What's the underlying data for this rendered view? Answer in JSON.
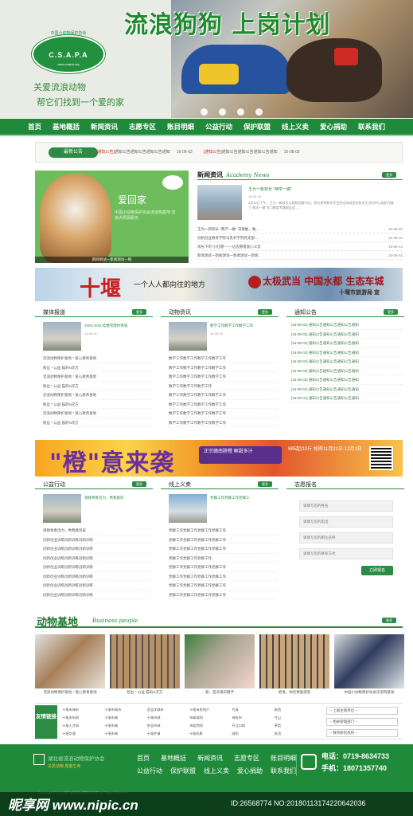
{
  "header": {
    "banner_title": "流浪狗狗 上岗计划",
    "logo_org_cn": "中国小动物保护协会",
    "logo_abbr": "C.S.A.P.A",
    "logo_url": "www.csapa.org",
    "slogan_line1": "关爱流浪动物",
    "slogan_line2": "帮它们找到一个爱的家",
    "slide_count": 4
  },
  "nav": {
    "items": [
      "首页",
      "基地概括",
      "新闻资讯",
      "志愿专区",
      "账目明细",
      "公益行动",
      "保护联盟",
      "线上义卖",
      "爱心捐助",
      "联系我们"
    ]
  },
  "announce": {
    "tag": "最新公告",
    "items": [
      {
        "tag": "[通知公告]",
        "text": "通知公告通知公告通知公告通知",
        "date": "16-08-02"
      },
      {
        "tag": "[通知公告]",
        "text": "通知公告通知公告通知公告通知",
        "date": "16-08-02"
      }
    ]
  },
  "feature": {
    "title": "爱回家",
    "subtitle": "中国小动物保护协会流浪狗基地 流浪犬照顾服务",
    "caption": "新闻测试一新闻测试一啊"
  },
  "news": {
    "title": "新闻资讯",
    "title_en": "Academy News",
    "more": "更多",
    "headline": "王为一新校长 \"两学一做\"",
    "headline_date": "16-08-20",
    "summary": "8月15日下午，王为一新校长与我院党委书记、院长带领院学生会的全体成员在校学生活动中心组织开展了\"两学一做\"学习教育专题报告会……",
    "list": [
      {
        "text": "王为一新校长 \"两学一做\" 决策推，做…",
        "date": "16-08-20"
      },
      {
        "text": "创新创业教育学院与乳杉学院党支部…",
        "date": "16-08-10"
      },
      {
        "text": "阳光下的\"小红帽\"——记志愿者爱心义卖",
        "date": "16-08-12"
      },
      {
        "text": "新闻测试一新闻测试一新闻测试一新闻",
        "date": "16-08-01"
      }
    ]
  },
  "ad1": {
    "big": "十堰",
    "tagline": "一个人人都向往的地方",
    "mountain": "太极武当 中国水都 生态车城",
    "bureau": "十堰市旅游局 宣"
  },
  "media": {
    "title": "媒体报道",
    "more": "更多",
    "thumb_title": "2005-2016 桂楼宅建村青城",
    "thumb_date": "16-08-02",
    "list": [
      "流浪动物保护基地 * 爱心救青基地",
      "粉丝 * 公益 猫的N次方",
      "流浪动物保护基地 * 爱心救青基地",
      "粉丝 * 公益 猫的N次方",
      "流浪动物保护基地 * 爱心救青基地",
      "粉丝 * 公益 猫的N次方",
      "流浪动物保护基地 * 爱心救青基地",
      "粉丝 * 公益 猫的N次方"
    ]
  },
  "activity": {
    "title": "动物资讯",
    "more": "更多",
    "thumb_title": "数学工作数学工作数学工作",
    "thumb_date": "16-08-20",
    "list": [
      "数学工作数学工作数学工作数学工作",
      "数学工作数学工作数学工作数学工作",
      "数学工作数学工作数学工作数学工作",
      "数学工作数学工作数学工作",
      "数学工作数学工作数学工作数学工作",
      "数学工作数学工作数学工作数学工作",
      "数学工作数学工作数学工作数学工作",
      "数学工作数学工作数学工作数学工作"
    ]
  },
  "notice": {
    "title": "通知公告",
    "more": "更多",
    "list": [
      "[16-08-02] 通知公告通知公告通知公告通知",
      "[16-08-02] 通知公告通知公告通知公告通知",
      "[16-08-02] 通知公告通知公告通知公告通知",
      "[16-08-02] 通知公告通知公告通知公告通知",
      "[16-08-02] 通知公告通知公告通知公告通知",
      "[16-08-02] 通知公告通知公告通知公告通知",
      "[16-08-02] 通知公告通知公告通知公告通知",
      "[16-08-01] 通知公告通知公告通知公告通知",
      "[16-08-01] 通知公告通知公告通知公告通知"
    ]
  },
  "ad2": {
    "title": "\"橙\"意来袭",
    "mid": "正宗赣南脐橙 鲜甜多汁",
    "right": "¥85起/10斤 抢购11月21日-12月1日"
  },
  "charity": {
    "title": "公益行动",
    "more": "更多",
    "thumb_title": "演绎青春活力，秀我真风",
    "list": [
      "演绎青春活力，秀我真风采",
      "创新创业训练创新训练创新训练",
      "创新创业训练创新训练创新训练",
      "创新创业训练创新训练创新训练",
      "创新创业训练创新训练创新训练",
      "创新创业训练创新训练创新训练",
      "创新创业训练创新训练创新训练",
      "创新创业训练创新训练创新训练"
    ]
  },
  "sale": {
    "title": "线上义卖",
    "more": "更多",
    "thumb_title": "党群工作党群工作党群工",
    "list": [
      "党群工作党群工作党群工作党群工作",
      "党群工作党群工作党群工作党群工作",
      "党群工作党群工作党群工作党群工作",
      "党群工作党群工作党群工作",
      "党群工作党群工作党群工作党群工作",
      "党群工作党群工作党群工作党群工作",
      "党群工作党群工作党群工作党群工作",
      "党群工作党群工作党群工作党群工作"
    ]
  },
  "volunteer": {
    "title": "志愿报名",
    "fields": [
      "请填写您的姓名",
      "请填写您的电话",
      "请填写您的职业名称",
      "请填写您的联系方式"
    ],
    "submit": "立即报名"
  },
  "animal": {
    "title": "动物基地",
    "title_en": "Business people",
    "photos": [
      {
        "caption": "流浪动物保护基地 * 爱心救青基地"
      },
      {
        "caption": "粉丝 * 公益 猫的N次方"
      },
      {
        "caption": "爱，是点滴的赠予"
      },
      {
        "caption": "绝境，你近更能感受"
      },
      {
        "caption": "中国小动物保护协会流浪狗基地"
      }
    ]
  },
  "links": {
    "label": "友情链接",
    "items": [
      "十堰市城市",
      "十堰市城市",
      "武当学城市",
      "十堰市房地产",
      "竹溪",
      "郧西",
      "十堰发布网",
      "十堰市城",
      "十堰市城",
      "市邮政网",
      "神农市",
      "竹山",
      "十堰人才网",
      "十堰市城",
      "房县市城",
      "市医院网",
      "丹江口网",
      "茅箭",
      "十堰交通",
      "十堰市城",
      "十堰乡镇",
      "十堰风景",
      "郧阳",
      "张湾"
    ],
    "selects": [
      "-- 上级主管单位 --",
      "-- 相关管理部门 --",
      "-- 教育研究机构 --"
    ]
  },
  "footer": {
    "org_name": "湖北省流浪动物保护协会",
    "org_sub": "关爱动物 尊重生命",
    "nav_row1": [
      "首页",
      "基地概括",
      "新闻资讯",
      "志愿专区",
      "账目明细"
    ],
    "nav_row2": [
      "公益行动",
      "保护联盟",
      "线上义卖",
      "爱心捐助",
      "联系我们"
    ],
    "phone": "电话：0719-8634733",
    "mobile": "手机：18071357740",
    "copyright": "Copyright © 2016 湖北省流浪动物保护协会 All Rights Reserved"
  },
  "watermark": {
    "site": "昵享网 www.nipic.cn",
    "id": "ID:26568774 NO:20180113174220642036"
  }
}
